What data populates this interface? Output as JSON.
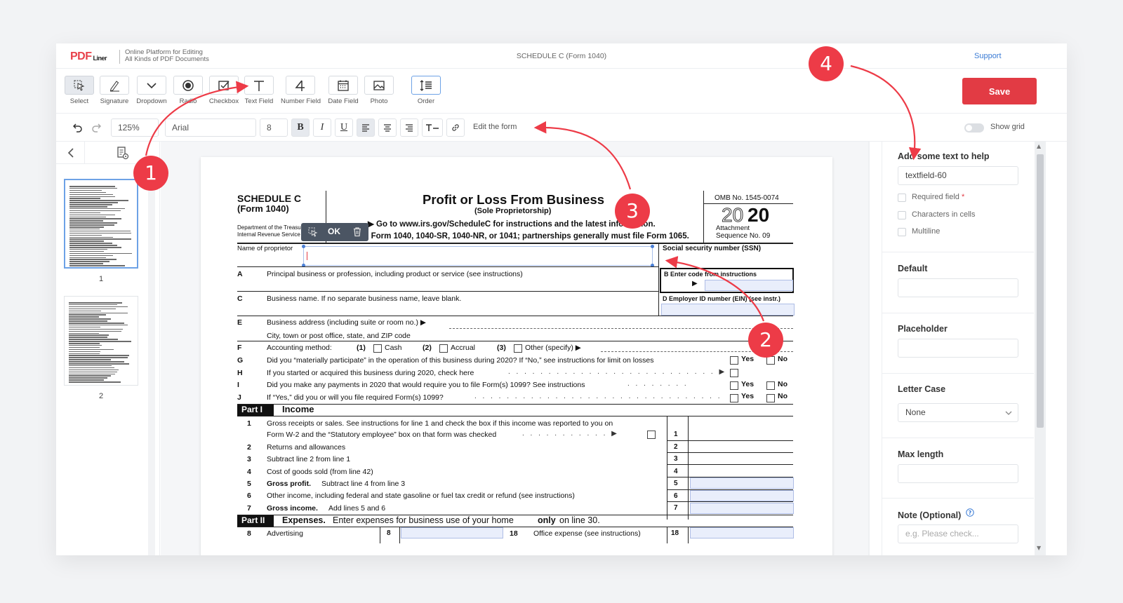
{
  "header": {
    "logo": "PDF",
    "logo_sub": "Liner",
    "tagline_1": "Online Platform for Editing",
    "tagline_2": "All Kinds of PDF Documents",
    "doc_title": "SCHEDULE C (Form 1040)",
    "support": "Support"
  },
  "toolbar": {
    "tools": [
      {
        "label": "Select",
        "icon": "select-icon"
      },
      {
        "label": "Signature",
        "icon": "signature-icon"
      },
      {
        "label": "Dropdown",
        "icon": "chevron-down-icon"
      },
      {
        "label": "Radio",
        "icon": "radio-icon"
      },
      {
        "label": "Checkbox",
        "icon": "checkbox-icon"
      },
      {
        "label": "Text Field",
        "icon": "text-field-icon"
      },
      {
        "label": "Number Field",
        "icon": "number-field-icon"
      },
      {
        "label": "Date Field",
        "icon": "calendar-icon"
      },
      {
        "label": "Photo",
        "icon": "photo-icon"
      },
      {
        "label": "Order",
        "icon": "order-icon"
      }
    ],
    "save_label": "Save"
  },
  "formatbar": {
    "zoom": "125%",
    "font": "Arial",
    "size": "8",
    "bold": "B",
    "italic": "I",
    "underline": "U",
    "edit_form": "Edit the form",
    "show_grid": "Show grid"
  },
  "pages": {
    "p1": "1",
    "p2": "2"
  },
  "field_popup": {
    "ok": "OK"
  },
  "form": {
    "schedule": "SCHEDULE C",
    "form_no": "(Form 1040)",
    "dept1": "Department of the Treasury",
    "dept2": "Internal Revenue Service",
    "title": "Profit or Loss From Business",
    "subtitle": "(Sole Proprietorship)",
    "goto": "▶ Go to www.irs.gov/ScheduleC for instructions and the latest information.",
    "attach": "▶ Attach to Form 1040, 1040-SR, 1040-NR, or 1041; partnerships generally must file Form 1065.",
    "omb": "OMB No. 1545-0074",
    "year_a": "20",
    "year_b": "20",
    "attachment": "Attachment",
    "seq": "Sequence No. 09",
    "name_label": "Name of proprietor",
    "ssn_label": "Social security number (SSN)",
    "A_letter": "A",
    "A_text": "Principal business or profession, including product or service (see instructions)",
    "B_text": "B  Enter code from instructions",
    "C_letter": "C",
    "C_text": "Business name. If no separate business name, leave blank.",
    "D_text": "D  Employer ID number (EIN) (see instr.)",
    "E_letter": "E",
    "E_text": "Business address (including suite or room no.) ▶",
    "E2_text": "City, town or post office, state, and ZIP code",
    "F_letter": "F",
    "F_text": "Accounting method:",
    "F1": "(1)",
    "F1_text": "Cash",
    "F2": "(2)",
    "F2_text": "Accrual",
    "F3": "(3)",
    "F3_text": "Other (specify) ▶",
    "G_letter": "G",
    "G_text": "Did you “materially participate” in the operation of this business during 2020? If “No,” see instructions for limit on losses",
    "H_letter": "H",
    "H_text": "If you started or acquired this business during 2020, check here",
    "I_letter": "I",
    "I_text": "Did you make any payments in 2020 that would require you to file Form(s) 1099? See instructions",
    "J_letter": "J",
    "J_text": "If “Yes,” did you or will you file required Form(s) 1099?",
    "yes": "Yes",
    "no": "No",
    "part1": "Part I",
    "part1_title": "Income",
    "l1_num": "1",
    "l1_text": "Gross receipts or sales. See instructions for line 1 and check the box if this income was reported to you on",
    "l1b_text": "Form W-2 and the “Statutory employee” box on that form was checked",
    "l2_num": "2",
    "l2_text": "Returns and allowances",
    "l3_num": "3",
    "l3_text": "Subtract line 2 from line 1",
    "l4_num": "4",
    "l4_text": "Cost of goods sold (from line 42)",
    "l5_num": "5",
    "l5_bold": "Gross profit.",
    "l5_text": "Subtract line 4 from line 3",
    "l6_num": "6",
    "l6_text": "Other income, including federal and state gasoline or fuel tax credit or refund (see instructions)",
    "l7_num": "7",
    "l7_bold": "Gross income.",
    "l7_text": "Add lines 5 and 6",
    "part2": "Part II",
    "part2_bold": "Expenses.",
    "part2_text": "Enter expenses for business use of your home",
    "part2_only": "only",
    "part2_end": "on line 30.",
    "l8_num": "8",
    "l8_text": "Advertising",
    "l18_num": "18",
    "l18_text": "Office expense (see instructions)"
  },
  "right_panel": {
    "help_label": "Add some text to help",
    "help_value": "textfield-60",
    "required": "Required field",
    "required_star": "*",
    "cells": "Characters in cells",
    "multiline": "Multiline",
    "default_label": "Default",
    "placeholder_label": "Placeholder",
    "lettercase_label": "Letter Case",
    "lettercase_value": "None",
    "maxlength_label": "Max length",
    "note_label": "Note (Optional)",
    "note_placeholder": "e.g. Please check..."
  },
  "annotations": {
    "b1": "1",
    "b2": "2",
    "b3": "3",
    "b4": "4"
  },
  "colors": {
    "accent": "#ED3B47",
    "save": "#E23B44",
    "link": "#3A7BD5",
    "field": "#E9EEFB"
  }
}
